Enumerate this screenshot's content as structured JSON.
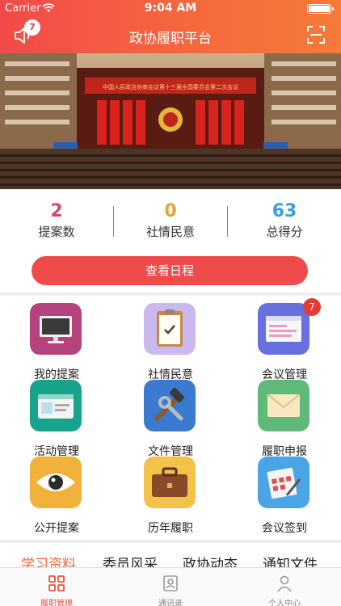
{
  "status_bar": {
    "carrier": "Carrier",
    "time": "9:04 AM"
  },
  "header": {
    "title": "政协履职平台",
    "notification_count": "7"
  },
  "banner": {
    "caption": "中国人民政治协商会议第十三届全国委员会第二次会议"
  },
  "stats": [
    {
      "value": "2",
      "label": "提案数",
      "color": "#d9476b"
    },
    {
      "value": "0",
      "label": "社情民意",
      "color": "#e8a33a"
    },
    {
      "value": "63",
      "label": "总得分",
      "color": "#3aa0e0"
    }
  ],
  "schedule_button": "查看日程",
  "grid": [
    {
      "label": "我的提案",
      "icon": "monitor-icon"
    },
    {
      "label": "社情民意",
      "icon": "clipboard-check-icon"
    },
    {
      "label": "会议管理",
      "icon": "meeting-window-icon",
      "badge": "7"
    },
    {
      "label": "活动管理",
      "icon": "id-card-icon"
    },
    {
      "label": "文件管理",
      "icon": "tools-icon"
    },
    {
      "label": "履职申报",
      "icon": "envelope-icon"
    },
    {
      "label": "公开提案",
      "icon": "eye-icon"
    },
    {
      "label": "历年履职",
      "icon": "briefcase-icon"
    },
    {
      "label": "会议签到",
      "icon": "calendar-sign-icon"
    }
  ],
  "category_tabs": [
    "学习资料",
    "委员风采",
    "政协动态",
    "通知文件"
  ],
  "tabbar": [
    {
      "label": "履职管理",
      "icon": "grid-icon"
    },
    {
      "label": "通讯录",
      "icon": "contacts-icon"
    },
    {
      "label": "个人中心",
      "icon": "person-icon"
    }
  ]
}
